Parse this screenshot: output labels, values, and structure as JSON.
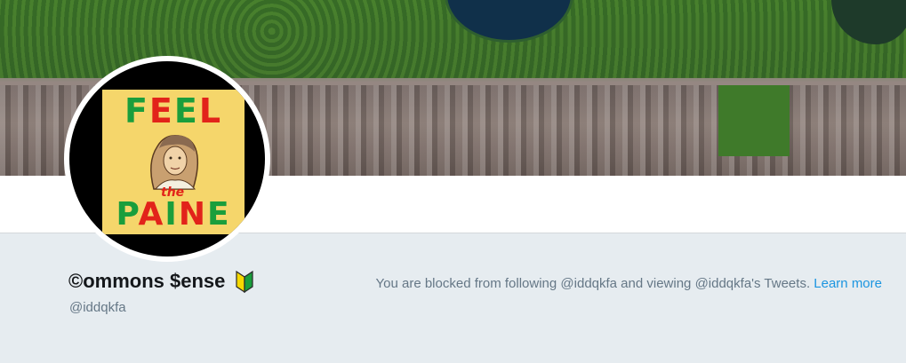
{
  "profile": {
    "display_name": "©ommons $ense",
    "handle": "@iddqkfa",
    "badge_icon": "beginner-leaf-icon"
  },
  "avatar": {
    "poster_text_top": "FEEL",
    "poster_text_mid": "the",
    "poster_text_bottom": "PAINE"
  },
  "notice": {
    "message": "You are blocked from following @iddqkfa and viewing @iddqkfa's Tweets.",
    "link_label": "Learn more",
    "link_color": "#1b95e0"
  },
  "colors": {
    "page_background": "#e6ecf0",
    "text_primary": "#14171a",
    "text_secondary": "#657786"
  }
}
